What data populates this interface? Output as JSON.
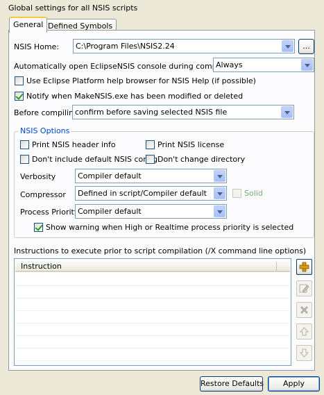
{
  "title": "Global settings for all NSIS scripts",
  "tabs": [
    {
      "label": "General"
    },
    {
      "label": "Defined Symbols"
    }
  ],
  "nsis_home": {
    "label": "NSIS Home:",
    "value": "C:\\Program Files\\NSIS2.24",
    "browse_label": "..."
  },
  "console": {
    "label": "Automatically open EclipseNSIS console during compilation:",
    "value": "Always"
  },
  "checks": {
    "eclipse_help": "Use Eclipse Platform help browser for NSIS Help (if possible)",
    "notify": "Notify when MakeNSIS.exe has been modified or deleted"
  },
  "before_compiling": {
    "label": "Before compiling",
    "value": "confirm before saving selected NSIS file"
  },
  "nsis_options": {
    "title": "NSIS Options",
    "print_header": "Print NSIS header info",
    "print_license": "Print NSIS license",
    "no_default_config": "Don't include default NSIS config",
    "no_change_dir": "Don't change directory",
    "verbosity_label": "Verbosity",
    "verbosity_value": "Compiler default",
    "compressor_label": "Compressor",
    "compressor_value": "Defined in script/Compiler default",
    "solid_label": "Solid",
    "priority_label": "Process Priority",
    "priority_value": "Compiler default",
    "show_warning": "Show warning when High or Realtime process priority is selected"
  },
  "instructions": {
    "label": "Instructions to execute prior to script compilation (/X command line options)",
    "column": "Instruction"
  },
  "buttons": {
    "restore": "Restore Defaults",
    "apply": "Apply"
  },
  "colors": {
    "group_title": "#0046d5",
    "tab_highlight": "#ffc83c",
    "add_icon": "#d99a1a"
  }
}
